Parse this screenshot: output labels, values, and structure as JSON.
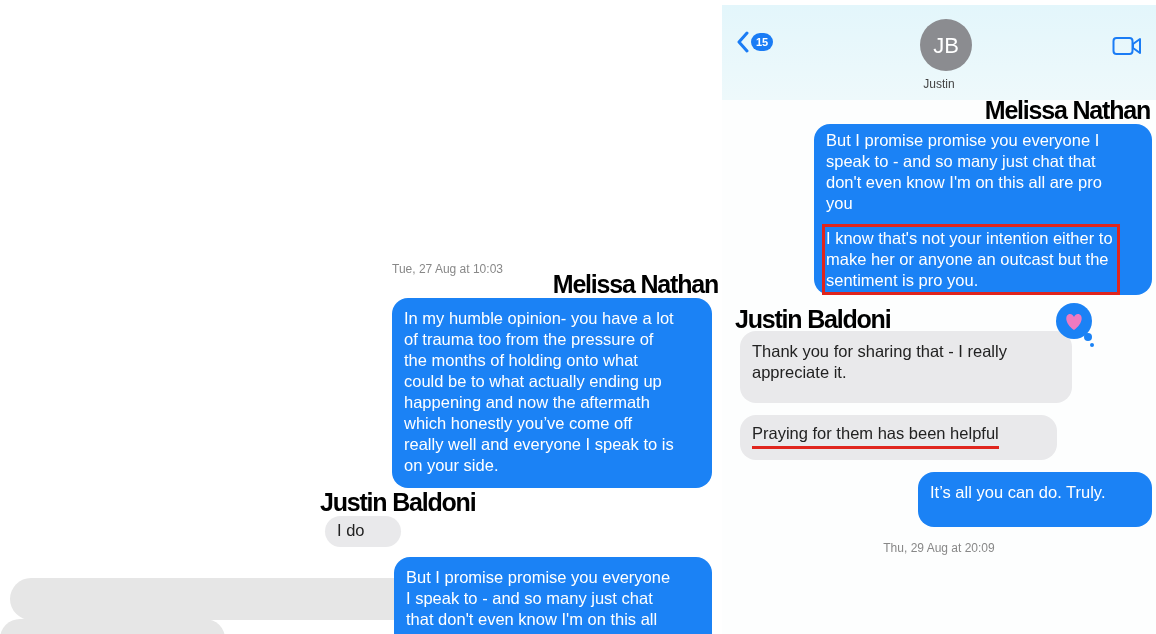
{
  "left_screenshot": {
    "items": [
      {
        "kind": "timestamp",
        "text": "Tue, 27 Aug at 10:03"
      },
      {
        "kind": "message",
        "sent": true,
        "sender_label": "Melissa Nathan",
        "paragraphs": [
          {
            "text": "In my humble opinion- you have a lot of trauma too from the pressure of the months of holding onto what could be to what actually ending up happening and now the aftermath which honestly you’ve come off really well and everyone I speak to is on your side."
          }
        ]
      },
      {
        "kind": "message",
        "sent": false,
        "sender_label": "Justin Baldoni",
        "paragraphs": [
          {
            "text": "I do"
          }
        ]
      },
      {
        "kind": "message",
        "sent": true,
        "paragraphs": [
          {
            "text": "But I promise promise you everyone I speak to - and so many just chat that don't even know I'm on this all"
          }
        ]
      }
    ]
  },
  "right_screenshot": {
    "header": {
      "back_badge": "15",
      "avatar_initials": "JB",
      "contact_name": "Justin"
    },
    "items": [
      {
        "kind": "message",
        "sent": true,
        "sender_label": "Melissa Nathan",
        "paragraphs": [
          {
            "text": "But I promise promise you everyone I speak to - and so many just chat that don't even know I'm on this all are pro you"
          },
          {
            "text": "I know that's not your intention either to make her or anyone an outcast but the sentiment is pro you.",
            "boxed": true
          }
        ]
      },
      {
        "kind": "message",
        "sent": false,
        "sender_label": "Justin Baldoni",
        "reaction": true,
        "paragraphs": [
          {
            "text": "Thank you for sharing that - I really appreciate it."
          }
        ]
      },
      {
        "kind": "message",
        "sent": false,
        "paragraphs": [
          {
            "text": "Praying for them has been helpful",
            "underlined": true
          }
        ]
      },
      {
        "kind": "message",
        "sent": true,
        "paragraphs": [
          {
            "text": "It’s all you can do. Truly."
          }
        ]
      },
      {
        "kind": "timestamp",
        "text": "Thu, 29 Aug at 20:09"
      }
    ]
  }
}
